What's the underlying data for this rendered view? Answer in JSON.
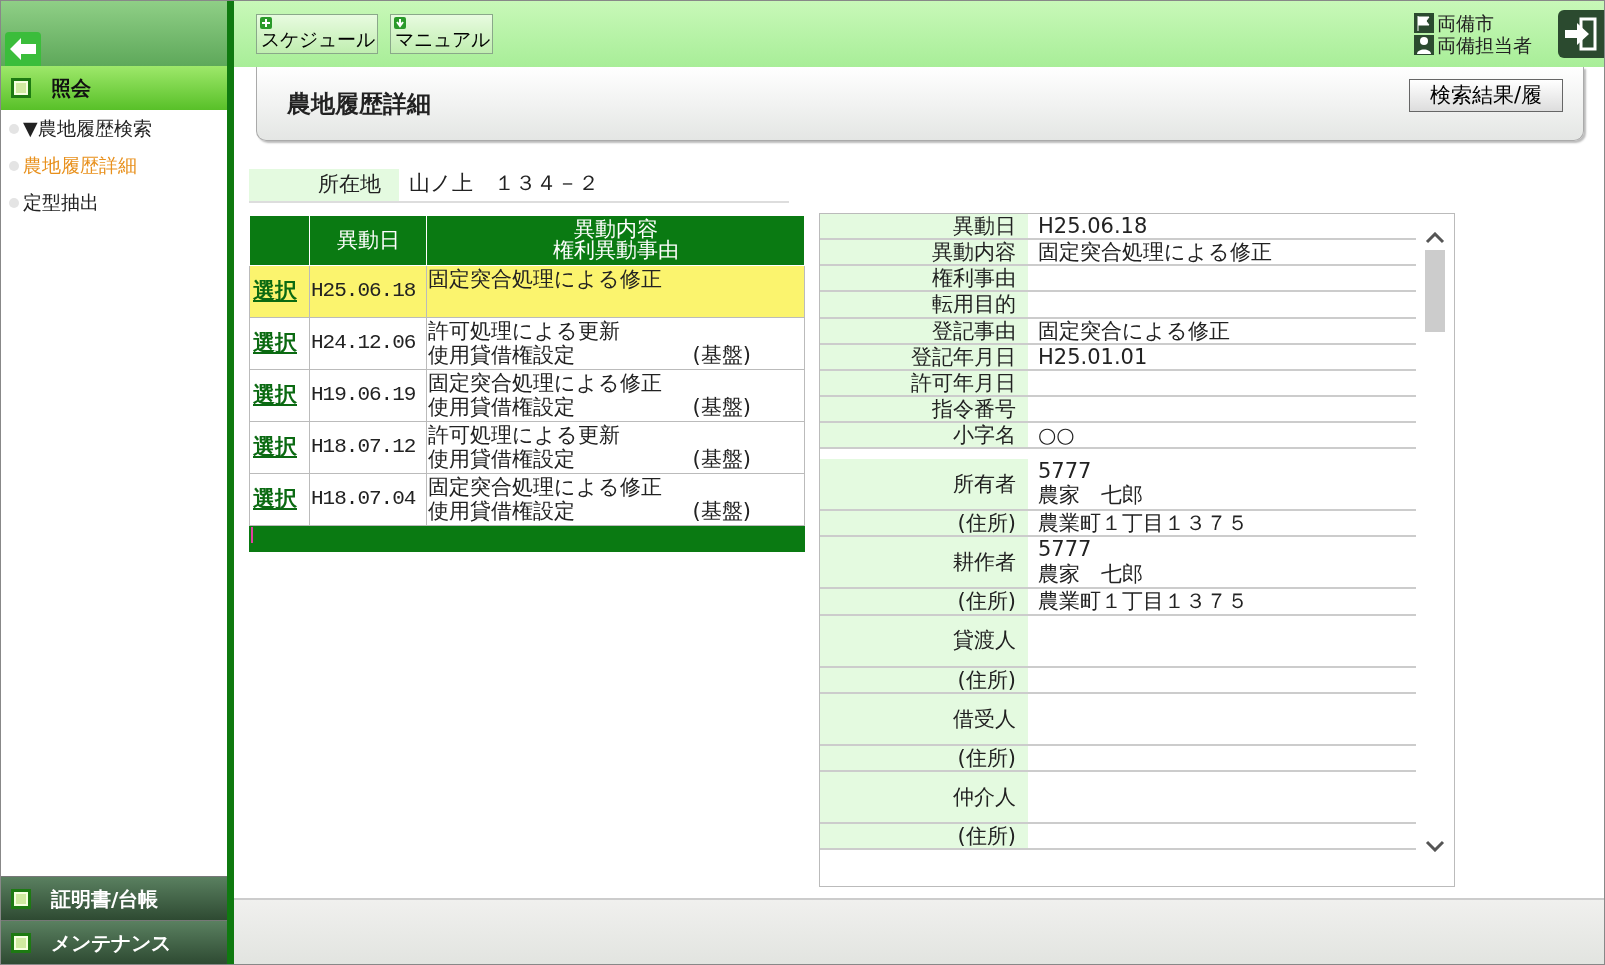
{
  "topbar": {
    "buttons": [
      {
        "label": "スケジュール"
      },
      {
        "label": "マニュアル"
      }
    ],
    "org": "両備市",
    "user": "両備担当者"
  },
  "sidebar": {
    "sections": [
      {
        "title": "照会",
        "expanded": true,
        "items": [
          {
            "label": "▼農地履歴検索",
            "selected": false
          },
          {
            "label": "農地履歴詳細",
            "selected": true
          },
          {
            "label": "定型抽出",
            "selected": false
          }
        ]
      },
      {
        "title": "証明書/台帳",
        "expanded": false
      },
      {
        "title": "メンテナンス",
        "expanded": false
      }
    ]
  },
  "page": {
    "title": "農地履歴詳細",
    "action": "検索結果/履"
  },
  "location": {
    "label": "所在地",
    "value": "山ノ上　１３４－２"
  },
  "history_table": {
    "columns": [
      {
        "lines": [
          "異動日"
        ]
      },
      {
        "lines": [
          "異動内容",
          "権利異動事由"
        ]
      }
    ],
    "rows": [
      {
        "link": "選択",
        "date": "H25.06.18",
        "content": "固定突合処理による修正",
        "selected": true
      },
      {
        "link": "選択",
        "date": "H24.12.06",
        "content": "許可処理による更新",
        "reason": "使用貸借権設定",
        "tag": "(基盤)",
        "selected": false
      },
      {
        "link": "選択",
        "date": "H19.06.19",
        "content": "固定突合処理による修正",
        "reason": "使用貸借権設定",
        "tag": "(基盤)",
        "selected": false
      },
      {
        "link": "選択",
        "date": "H18.07.12",
        "content": "許可処理による更新",
        "reason": "使用貸借権設定",
        "tag": "(基盤)",
        "selected": false
      },
      {
        "link": "選択",
        "date": "H18.07.04",
        "content": "固定突合処理による修正",
        "reason": "使用貸借権設定",
        "tag": "(基盤)",
        "selected": false
      }
    ]
  },
  "details": {
    "groups": [
      [
        {
          "label": "異動日",
          "values": [
            "H25.06.18"
          ]
        },
        {
          "label": "異動内容",
          "values": [
            "固定突合処理による修正"
          ]
        },
        {
          "label": "権利事由"
        },
        {
          "label": "転用目的"
        },
        {
          "label": "登記事由",
          "values": [
            "固定突合による修正"
          ]
        },
        {
          "label": "登記年月日",
          "values": [
            "H25.01.01"
          ]
        },
        {
          "label": "許可年月日"
        },
        {
          "label": "指令番号"
        },
        {
          "label": "小字名",
          "values": [
            "○○"
          ]
        }
      ],
      [
        {
          "label": "所有者",
          "values": [
            "5777",
            "農家　七郎"
          ],
          "kind": "party"
        },
        {
          "label": "(住所)",
          "values": [
            "農業町１丁目１３７５"
          ],
          "kind": "address"
        },
        {
          "label": "耕作者",
          "values": [
            "5777",
            "農家　七郎"
          ],
          "kind": "party"
        },
        {
          "label": "(住所)",
          "values": [
            "農業町１丁目１３７５"
          ],
          "kind": "address"
        },
        {
          "label": "貸渡人",
          "kind": "party"
        },
        {
          "label": "(住所)",
          "kind": "address"
        },
        {
          "label": "借受人",
          "kind": "party"
        },
        {
          "label": "(住所)",
          "kind": "address"
        },
        {
          "label": "仲介人",
          "kind": "party"
        },
        {
          "label": "(住所)",
          "kind": "address"
        }
      ]
    ]
  }
}
